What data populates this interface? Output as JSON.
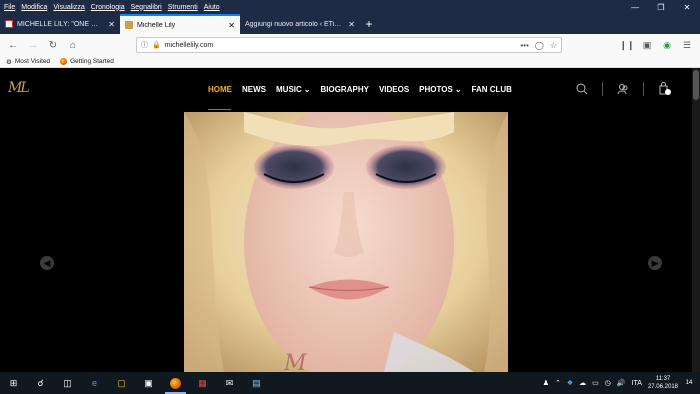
{
  "menubar": [
    "File",
    "Modifica",
    "Visualizza",
    "Cronologia",
    "Segnalibri",
    "Strumenti",
    "Aiuto"
  ],
  "tabs": [
    {
      "title": "MICHELLE LILY: \"ONE WORLD\"",
      "favicon": "gmail-icon",
      "active": false
    },
    {
      "title": "Michelle Lily",
      "favicon": "ml-logo-icon",
      "active": true
    },
    {
      "title": "Aggiungi nuovo articolo ‹ ETiCinf",
      "favicon": "none",
      "active": false
    }
  ],
  "urlbar": {
    "url": "michellelily.com"
  },
  "bookmarks": [
    {
      "label": "Most Visited",
      "icon": "gear-icon"
    },
    {
      "label": "Getting Started",
      "icon": "firefox-icon"
    }
  ],
  "site": {
    "logo": "ML",
    "nav": [
      {
        "label": "HOME",
        "active": true,
        "dropdown": false
      },
      {
        "label": "NEWS",
        "active": false,
        "dropdown": false
      },
      {
        "label": "MUSIC",
        "active": false,
        "dropdown": true
      },
      {
        "label": "BIOGRAPHY",
        "active": false,
        "dropdown": false
      },
      {
        "label": "VIDEOS",
        "active": false,
        "dropdown": false
      },
      {
        "label": "PHOTOS",
        "active": false,
        "dropdown": true
      },
      {
        "label": "FAN CLUB",
        "active": false,
        "dropdown": false
      }
    ],
    "accent": "#f2b01e"
  },
  "taskbar": {
    "language": "ITA",
    "time": "11:37",
    "date": "27.06.2018",
    "notifications": "14"
  }
}
